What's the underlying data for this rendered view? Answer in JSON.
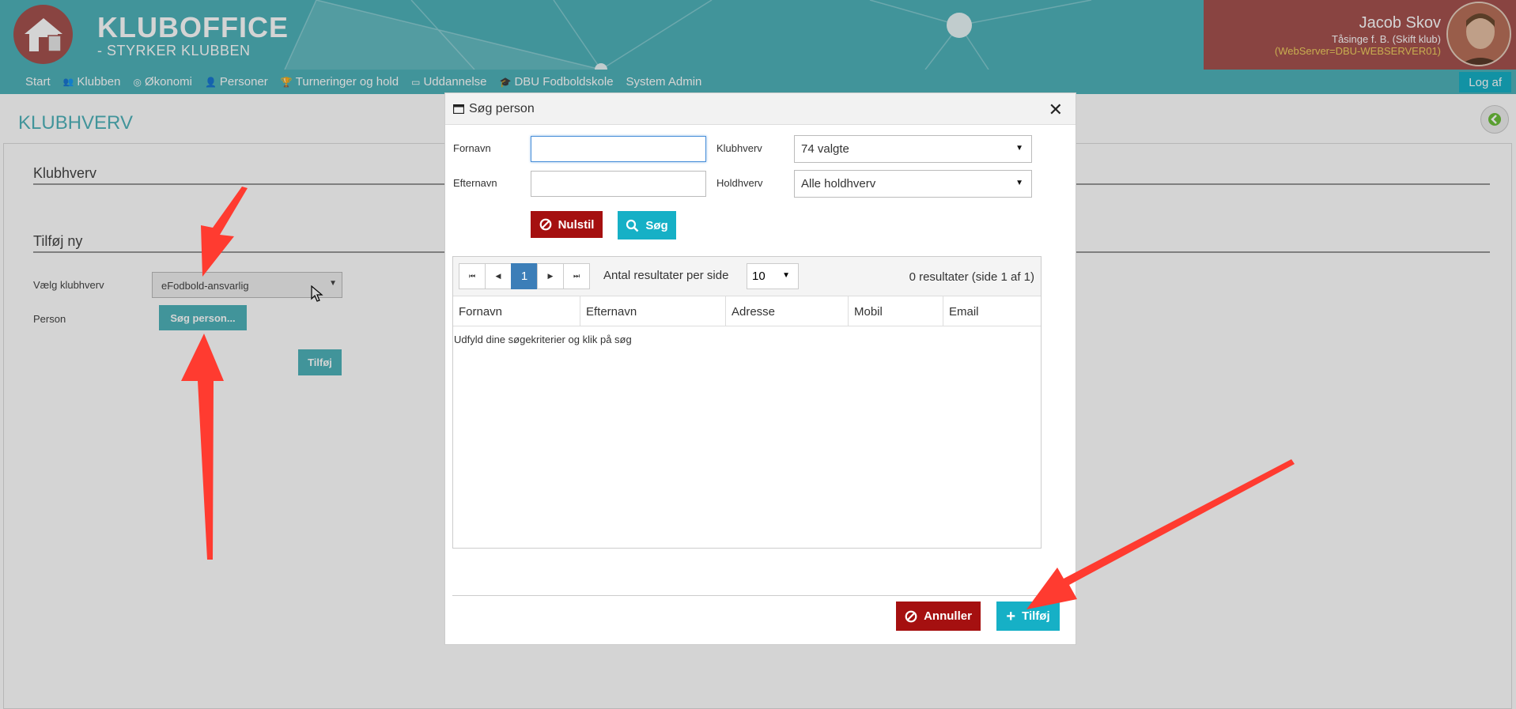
{
  "header": {
    "app_title": "KLUBOFFICE",
    "app_subtitle": "- STYRKER KLUBBEN",
    "user_name": "Jacob Skov",
    "user_club": "Tåsinge f. B. (Skift klub)",
    "user_server": "(WebServer=DBU-WEBSERVER01)"
  },
  "nav": {
    "items": [
      {
        "label": "Start",
        "icon": "none"
      },
      {
        "label": "Klubben",
        "icon": "people-icon"
      },
      {
        "label": "Økonomi",
        "icon": "coin-icon"
      },
      {
        "label": "Personer",
        "icon": "person-icon"
      },
      {
        "label": "Turneringer og hold",
        "icon": "trophy-icon"
      },
      {
        "label": "Uddannelse",
        "icon": "screen-icon"
      },
      {
        "label": "DBU Fodboldskole",
        "icon": "graduation-cap-icon"
      },
      {
        "label": "System Admin",
        "icon": "none"
      }
    ],
    "logout_label": "Log af"
  },
  "page": {
    "title": "KLUBHVERV",
    "section1": "Klubhverv",
    "section2": "Tilføj ny",
    "select_label": "Vælg klubhverv",
    "select_value": "eFodbold-ansvarlig",
    "person_label": "Person",
    "search_person_button": "Søg person...",
    "add_button": "Tilføj"
  },
  "modal": {
    "title": "Søg person",
    "firstname_label": "Fornavn",
    "firstname_value": "",
    "lastname_label": "Efternavn",
    "lastname_value": "",
    "clubrole_label": "Klubhverv",
    "clubrole_value": "74 valgte",
    "teamrole_label": "Holdhverv",
    "teamrole_value": "Alle holdhverv",
    "reset_button": "Nulstil",
    "search_button": "Søg",
    "pager": {
      "current_page": "1",
      "per_page_label": "Antal resultater per side",
      "per_page_value": "10",
      "result_text": "0 resultater (side 1 af 1)"
    },
    "columns": [
      "Fornavn",
      "Efternavn",
      "Adresse",
      "Mobil",
      "Email"
    ],
    "empty_message": "Udfyld dine søgekriterier og klik på søg",
    "cancel_button": "Annuller",
    "add_button": "Tilføj"
  },
  "colors": {
    "brand_teal": "#4fb3ba",
    "brand_red": "#a5524f",
    "danger": "#a51010",
    "accent_cyan": "#16b0c6",
    "annotation_arrow": "#ff3b30"
  }
}
